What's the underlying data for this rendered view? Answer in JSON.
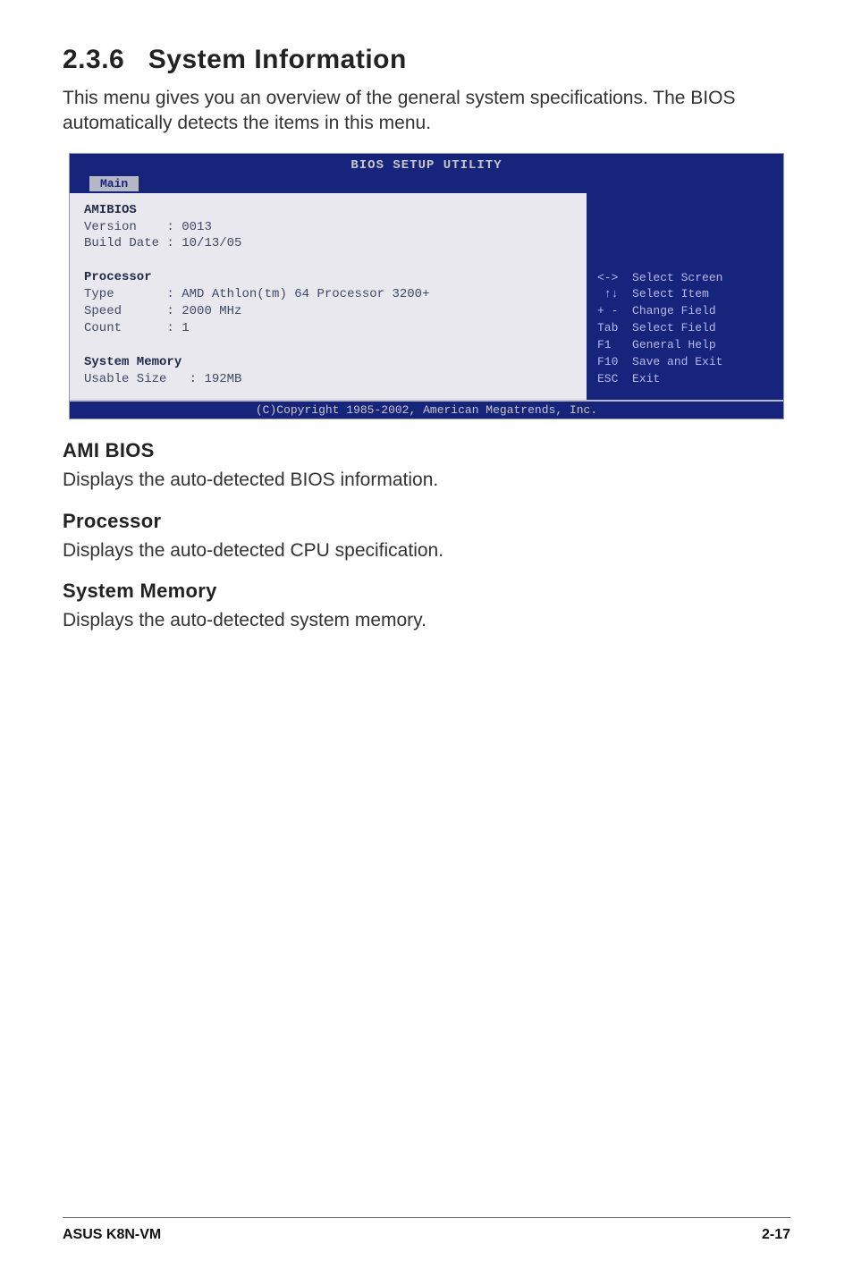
{
  "section": {
    "number": "2.3.6",
    "title": "System Information",
    "intro": "This menu gives you an overview of the general system specifications. The BIOS automatically detects the items in this menu."
  },
  "bios": {
    "utility_title": "BIOS SETUP UTILITY",
    "tab_label": "Main",
    "amibios": {
      "heading": "AMIBIOS",
      "version_label": "Version",
      "version_value": "0013",
      "build_label": "Build Date",
      "build_value": "10/13/05"
    },
    "processor": {
      "heading": "Processor",
      "type_label": "Type",
      "type_value": "AMD Athlon(tm) 64 Processor 3200+",
      "speed_label": "Speed",
      "speed_value": "2000 MHz",
      "count_label": "Count",
      "count_value": "1"
    },
    "memory": {
      "heading": "System Memory",
      "usable_label": "Usable Size",
      "usable_value": "192MB"
    },
    "help": [
      {
        "key": "<->",
        "text": "Select Screen"
      },
      {
        "key": "↑↓",
        "text": "Select Item"
      },
      {
        "key": "+ -",
        "text": "Change Field"
      },
      {
        "key": "Tab",
        "text": "Select Field"
      },
      {
        "key": "F1",
        "text": "General Help"
      },
      {
        "key": "F10",
        "text": "Save and Exit"
      },
      {
        "key": "ESC",
        "text": "Exit"
      }
    ],
    "copyright": "(C)Copyright 1985-2002, American Megatrends, Inc."
  },
  "subsections": {
    "ami_bios": {
      "title": "AMI BIOS",
      "text": "Displays the auto-detected BIOS information."
    },
    "processor": {
      "title": "Processor",
      "text": "Displays the auto-detected CPU specification."
    },
    "system_memory": {
      "title": "System Memory",
      "text": "Displays the auto-detected system memory."
    }
  },
  "footer": {
    "left": "ASUS K8N-VM",
    "right": "2-17"
  }
}
